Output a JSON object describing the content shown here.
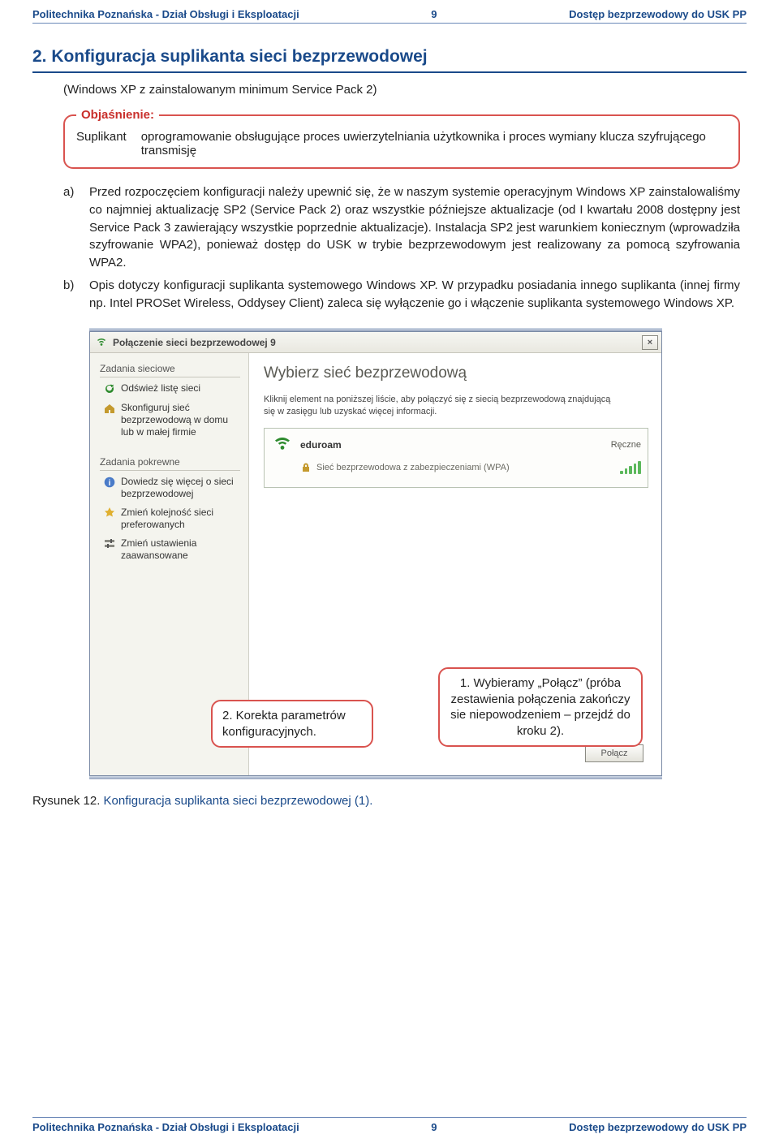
{
  "header": {
    "left": "Politechnika Poznańska - Dział Obsługi i Eksploatacji",
    "page": "9",
    "right": "Dostęp bezprzewodowy do USK PP"
  },
  "section": {
    "title": "2. Konfiguracja suplikanta sieci bezprzewodowej",
    "subtitle": "(Windows XP z zainstalowanym minimum Service Pack 2)"
  },
  "callout": {
    "legend": "Objaśnienie:",
    "term": "Suplikant",
    "def": "oprogramowanie obsługujące proces uwierzytelniania użytkownika i proces wymiany klucza szyfrującego transmisję"
  },
  "letters": {
    "a": {
      "ltr": "a)",
      "txt": "Przed rozpoczęciem konfiguracji należy upewnić się, że w naszym systemie operacyjnym Windows XP zainstalowaliśmy co najmniej aktualizację SP2 (Service Pack 2) oraz wszystkie późniejsze aktualizacje (od I kwartału 2008 dostępny jest Service Pack 3 zawierający wszystkie poprzednie aktualizacje). Instalacja SP2 jest warunkiem koniecznym (wprowadziła szyfrowanie WPA2), ponieważ dostęp do USK w trybie bezprzewodowym jest realizowany za pomocą szyfrowania WPA2."
    },
    "b": {
      "ltr": "b)",
      "txt": "Opis dotyczy konfiguracji suplikanta systemowego Windows XP. W przypadku posiadania innego suplikanta (innej firmy np. Intel PROSet Wireless, Oddysey Client) zaleca się wyłączenie go i włączenie suplikanta systemowego Windows XP."
    }
  },
  "window": {
    "title": "Połączenie sieci bezprzewodowej 9",
    "close": "×",
    "left": {
      "group1": "Zadania sieciowe",
      "task_refresh": "Odśwież listę sieci",
      "task_config": "Skonfiguruj sieć bezprzewodową w domu lub w małej firmie",
      "group2": "Zadania pokrewne",
      "task_learn": "Dowiedz się więcej o sieci bezprzewodowej",
      "task_order": "Zmień kolejność sieci preferowanych",
      "task_adv": "Zmień ustawienia zaawansowane"
    },
    "right": {
      "bigtitle": "Wybierz sieć bezprzewodową",
      "desc": "Kliknij element na poniższej liście, aby połączyć się z siecią bezprzewodową znajdującą się w zasięgu lub uzyskać więcej informacji.",
      "netname": "eduroam",
      "mode": "Ręczne",
      "secure": "Sieć bezprzewodowa z zabezpieczeniami (WPA)",
      "connect": "Połącz"
    }
  },
  "annot": {
    "a2": "2. Korekta parametrów konfiguracyjnych.",
    "a1": "1. Wybieramy „Połącz” (próba zestawienia połączenia zakończy sie niepowodzeniem – przejdź do kroku 2)."
  },
  "figcap": {
    "num": "Rysunek 12. ",
    "txt": "Konfiguracja suplikanta sieci bezprzewodowej (1)."
  },
  "footer": {
    "left": "Politechnika Poznańska - Dział Obsługi i Eksploatacji",
    "page": "9",
    "right": "Dostęp bezprzewodowy do USK PP"
  }
}
